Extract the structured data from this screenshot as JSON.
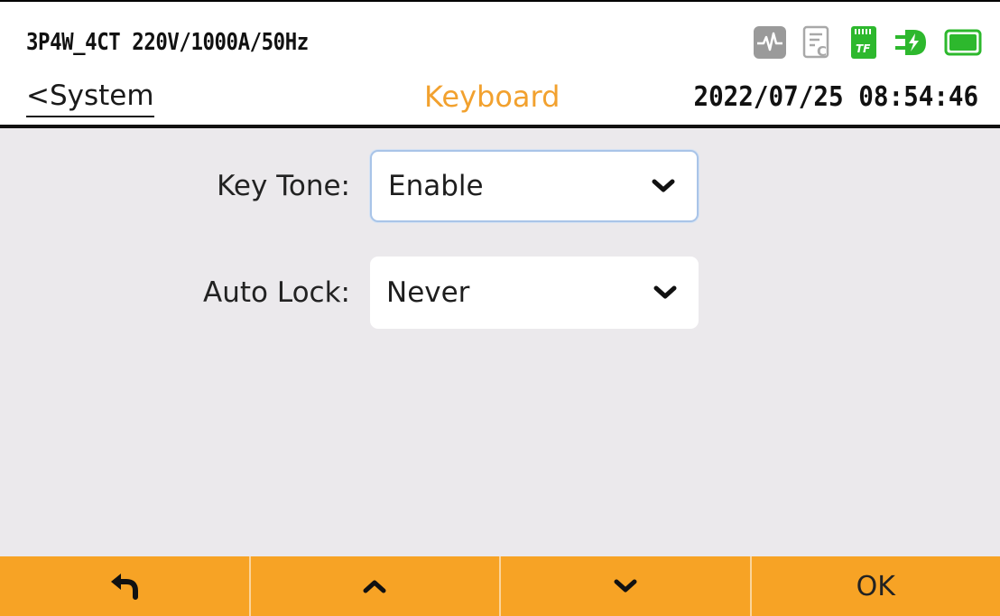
{
  "header": {
    "config": "3P4W_4CT 220V/1000A/50Hz",
    "back_label": "<System",
    "title": "Keyboard",
    "datetime": "2022/07/25 08:54:46",
    "status_icons": [
      "waveform-icon",
      "report-icon",
      "tf-card-icon",
      "power-plug-icon",
      "battery-icon"
    ],
    "tf_label": "TF"
  },
  "settings": {
    "key_tone": {
      "label": "Key Tone:",
      "value": "Enable"
    },
    "auto_lock": {
      "label": "Auto Lock:",
      "value": "Never"
    }
  },
  "function_keys": {
    "back": {
      "icon": "return-arrow-icon"
    },
    "up": {
      "icon": "chevron-up-icon"
    },
    "down": {
      "icon": "chevron-down-icon"
    },
    "ok": {
      "label": "OK"
    }
  },
  "colors": {
    "accent_orange": "#f7a325",
    "title_orange": "#f2a12e",
    "status_green": "#2db82d",
    "content_bg": "#ebe9ec"
  }
}
